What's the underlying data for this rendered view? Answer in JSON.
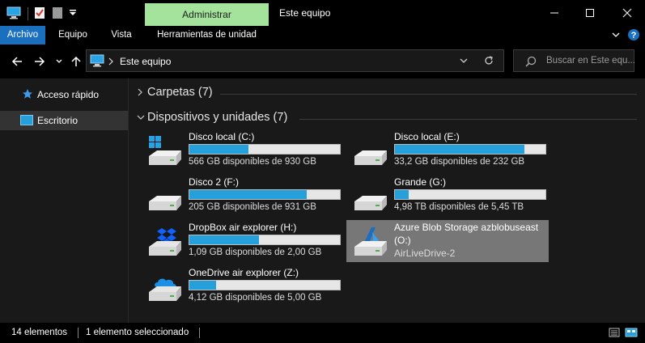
{
  "window": {
    "title": "Este equipo",
    "contextual_tab": "Administrar"
  },
  "ribbon": {
    "tabs": [
      "Archivo",
      "Equipo",
      "Vista",
      "Herramientas de unidad"
    ]
  },
  "address": {
    "path": "Este equipo"
  },
  "search": {
    "placeholder": "Buscar en Este equ..."
  },
  "nav": {
    "items": [
      {
        "label": "Acceso rápido",
        "icon": "star-icon"
      },
      {
        "label": "Escritorio",
        "icon": "desktop-icon"
      }
    ]
  },
  "groups": {
    "folders": "Carpetas (7)",
    "devices": "Dispositivos y unidades (7)"
  },
  "drives": [
    {
      "name": "Disco local (C:)",
      "free": "566 GB disponibles de 930 GB",
      "used_fraction": 0.39,
      "icon": "windows-drive-icon"
    },
    {
      "name": "Disco local (E:)",
      "free": "33,2 GB disponibles de 232 GB",
      "used_fraction": 0.86,
      "icon": "drive-icon"
    },
    {
      "name": "Disco 2 (F:)",
      "free": "205 GB disponibles de 931 GB",
      "used_fraction": 0.78,
      "icon": "drive-icon"
    },
    {
      "name": "Grande (G:)",
      "free": "4,98 TB disponibles de 5,45 TB",
      "used_fraction": 0.09,
      "icon": "drive-icon"
    },
    {
      "name": "DropBox air explorer (H:)",
      "free": "1,09 GB disponibles de 2,00 GB",
      "used_fraction": 0.46,
      "icon": "dropbox-drive-icon"
    },
    {
      "name": "Azure Blob Storage azblobuseast",
      "name_line2": "(O:)",
      "subtitle": "AirLiveDrive-2",
      "icon": "azure-drive-icon"
    },
    {
      "name": "OneDrive air explorer (Z:)",
      "free": "4,12 GB disponibles de 5,00 GB",
      "used_fraction": 0.18,
      "icon": "onedrive-drive-icon"
    }
  ],
  "status": {
    "count": "14 elementos",
    "selected": "1 elemento seleccionado"
  },
  "colors": {
    "accent": "#1a6fbf",
    "contextual_tab": "#a3e39b",
    "bar_fill": "#26a0da",
    "selected_item": "#777777"
  }
}
